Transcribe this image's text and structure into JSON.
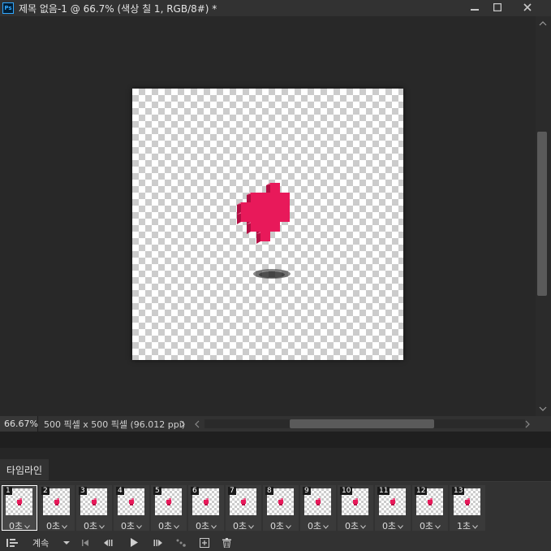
{
  "window": {
    "title": "제목 없음-1 @ 66.7% (색상 칠 1, RGB/8#) *",
    "app_icon_label": "Ps"
  },
  "status": {
    "zoom": "66.67%",
    "doc_info": "500 픽셀 x 500 픽셀 (96.012 ppi)"
  },
  "panel": {
    "tab_label": "타임라인"
  },
  "frames": [
    {
      "num": "1",
      "delay": "0초"
    },
    {
      "num": "2",
      "delay": "0초"
    },
    {
      "num": "3",
      "delay": "0초"
    },
    {
      "num": "4",
      "delay": "0초"
    },
    {
      "num": "5",
      "delay": "0초"
    },
    {
      "num": "6",
      "delay": "0초"
    },
    {
      "num": "7",
      "delay": "0초"
    },
    {
      "num": "8",
      "delay": "0초"
    },
    {
      "num": "9",
      "delay": "0초"
    },
    {
      "num": "10",
      "delay": "0초"
    },
    {
      "num": "11",
      "delay": "0초"
    },
    {
      "num": "12",
      "delay": "0초"
    },
    {
      "num": "13",
      "delay": "1초"
    }
  ],
  "toolbar": {
    "loop_label": "계속"
  },
  "colors": {
    "heart_front": "#e8195a",
    "heart_top": "#f25b8b",
    "heart_side": "#b30f44",
    "accent_ps": "#31a8ff"
  }
}
